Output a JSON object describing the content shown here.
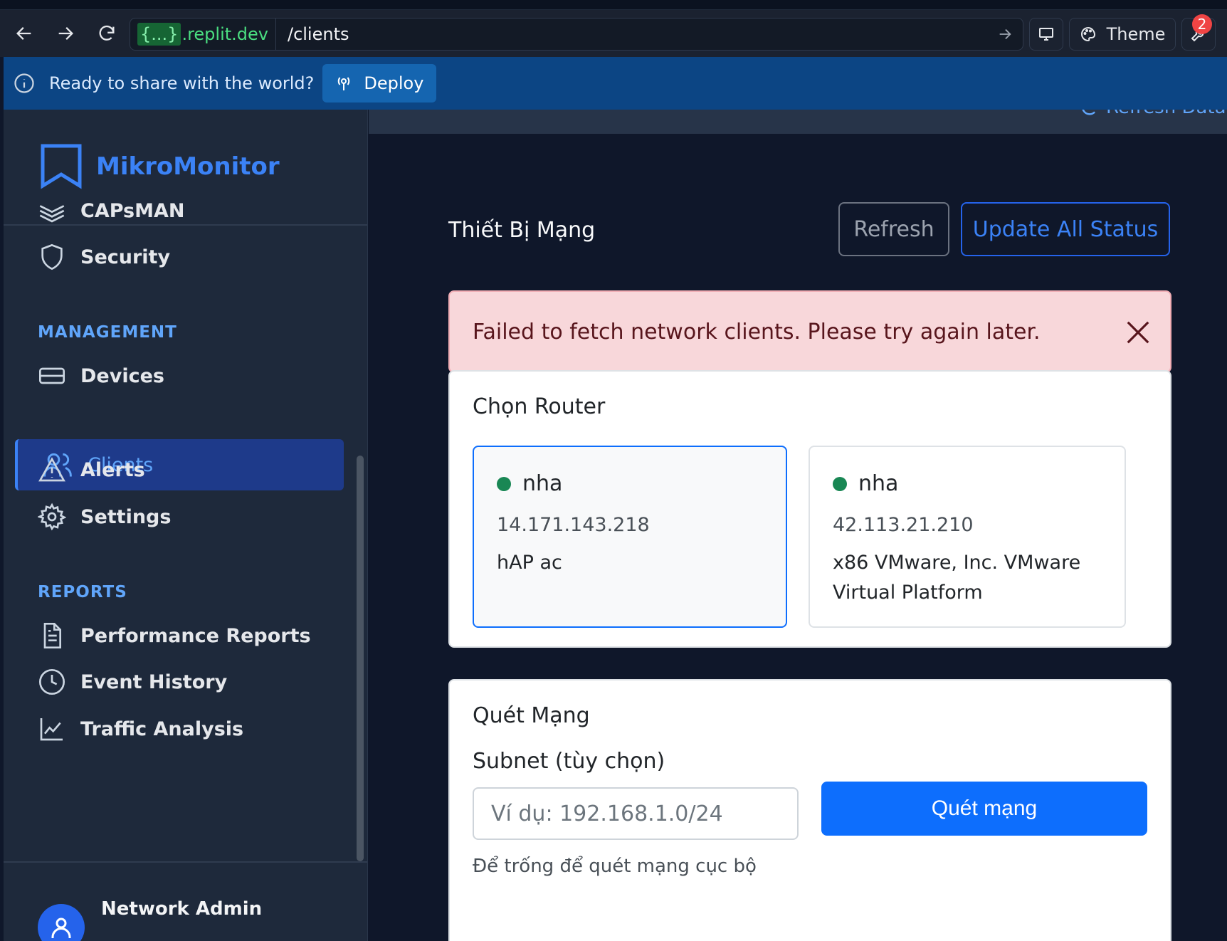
{
  "browser": {
    "domain_prefix": "{...}",
    "domain_suffix": ".replit.dev",
    "path": "/clients",
    "theme_label": "Theme",
    "notification_count": "2"
  },
  "banner": {
    "message": "Ready to share with the world?",
    "deploy_label": "Deploy"
  },
  "sidebar": {
    "brand": "MikroMonitor",
    "top_items": [
      {
        "label": "CAPsMAN",
        "icon": "layers-icon"
      },
      {
        "label": "Security",
        "icon": "shield-icon"
      }
    ],
    "management_label": "MANAGEMENT",
    "management_items": [
      {
        "label": "Devices",
        "icon": "server-icon"
      },
      {
        "label": "Clients",
        "icon": "users-icon",
        "active": true
      },
      {
        "label": "Alerts",
        "icon": "warning-icon"
      },
      {
        "label": "Settings",
        "icon": "gear-icon"
      }
    ],
    "reports_label": "REPORTS",
    "reports_items": [
      {
        "label": "Performance Reports",
        "icon": "document-icon"
      },
      {
        "label": "Event History",
        "icon": "clock-icon"
      },
      {
        "label": "Traffic Analysis",
        "icon": "chart-icon"
      }
    ],
    "user": {
      "name": "Network Admin"
    }
  },
  "main": {
    "header_action": "Refresh Data",
    "title": "Thiết Bị Mạng",
    "refresh_label": "Refresh",
    "update_label": "Update All Status",
    "error_message": "Failed to fetch network clients. Please try again later.",
    "router_card": {
      "title": "Chọn Router",
      "routers": [
        {
          "name": "nha",
          "ip": "14.171.143.218",
          "model": "hAP ac",
          "selected": true,
          "status_color": "#198754"
        },
        {
          "name": "nha",
          "ip": "42.113.21.210",
          "model": "x86 VMware, Inc. VMware Virtual Platform",
          "selected": false,
          "status_color": "#198754"
        }
      ]
    },
    "scan_card": {
      "title": "Quét Mạng",
      "subnet_label": "Subnet (tùy chọn)",
      "subnet_value": "",
      "subnet_placeholder": "Ví dụ: 192.168.1.0/24",
      "scan_button": "Quét mạng",
      "help_text": "Để trống để quét mạng cục bộ"
    }
  },
  "colors": {
    "accent": "#3b82f6",
    "primary_button": "#0d6efd",
    "alert_bg": "#f8d7da",
    "sidebar_bg": "#1e293b",
    "main_bg": "#0f172a"
  }
}
